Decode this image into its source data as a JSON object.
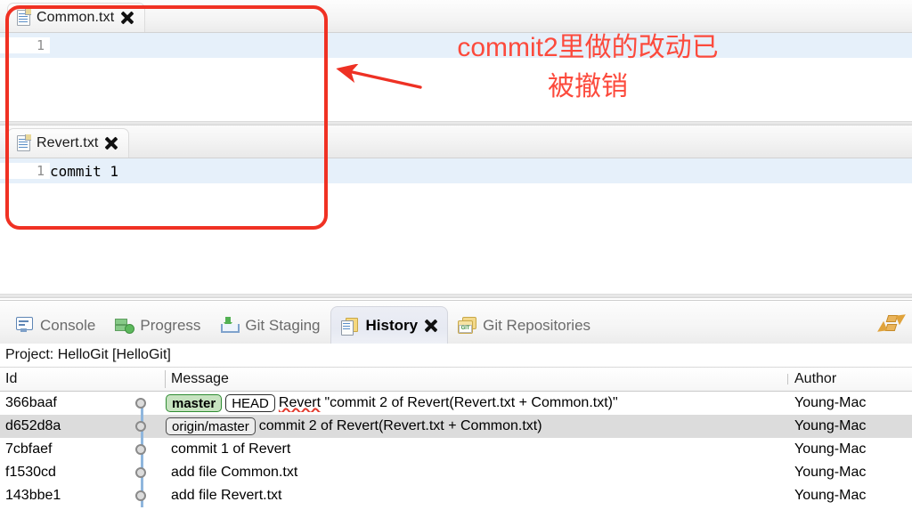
{
  "editors": [
    {
      "tab_title": "Common.txt",
      "icon": "text-file-icon",
      "close_icon": "close-icon",
      "lines": [
        {
          "number": "1",
          "text": ""
        }
      ]
    },
    {
      "tab_title": "Revert.txt",
      "icon": "text-file-icon",
      "close_icon": "close-icon",
      "lines": [
        {
          "number": "1",
          "text": "commit 1"
        }
      ]
    }
  ],
  "bottom_panel": {
    "tabs": [
      {
        "label": "Console",
        "icon": "console-icon",
        "active": false
      },
      {
        "label": "Progress",
        "icon": "progress-icon",
        "active": false
      },
      {
        "label": "Git Staging",
        "icon": "git-staging-icon",
        "active": false
      },
      {
        "label": "History",
        "icon": "history-icon",
        "active": true
      },
      {
        "label": "Git Repositories",
        "icon": "git-repositories-icon",
        "active": false
      }
    ],
    "toolbar": {
      "refresh_icon": "refresh-arrows-icon"
    },
    "project_label": "Project: HelloGit [HelloGit]",
    "table": {
      "columns": [
        "Id",
        "Message",
        "Author"
      ],
      "rows": [
        {
          "id": "366baaf",
          "refs": [
            {
              "label": "master",
              "type": "branch"
            },
            {
              "label": "HEAD",
              "type": "head"
            }
          ],
          "message_spell": "Revert",
          "message": " \"commit 2 of Revert(Revert.txt + Common.txt)\"",
          "author": "Young-Mac",
          "selected": false
        },
        {
          "id": "d652d8a",
          "refs": [
            {
              "label": "origin/master",
              "type": "remote"
            }
          ],
          "message_spell": "",
          "message": "commit 2 of Revert(Revert.txt + Common.txt)",
          "author": "Young-Mac",
          "selected": true
        },
        {
          "id": "7cbfaef",
          "refs": [],
          "message_spell": "",
          "message": "commit 1 of Revert",
          "author": "Young-Mac",
          "selected": false
        },
        {
          "id": "f1530cd",
          "refs": [],
          "message_spell": "",
          "message": "add file Common.txt",
          "author": "Young-Mac",
          "selected": false
        },
        {
          "id": "143bbe1",
          "refs": [],
          "message_spell": "",
          "message": "add file Revert.txt",
          "author": "Young-Mac",
          "selected": false
        }
      ]
    }
  },
  "annotation": {
    "line1": "commit2里做的改动已",
    "line2": "被撤销",
    "color": "#fc4a3c",
    "box_color": "#f03123",
    "arrow_icon": "left-arrow-annotation"
  }
}
